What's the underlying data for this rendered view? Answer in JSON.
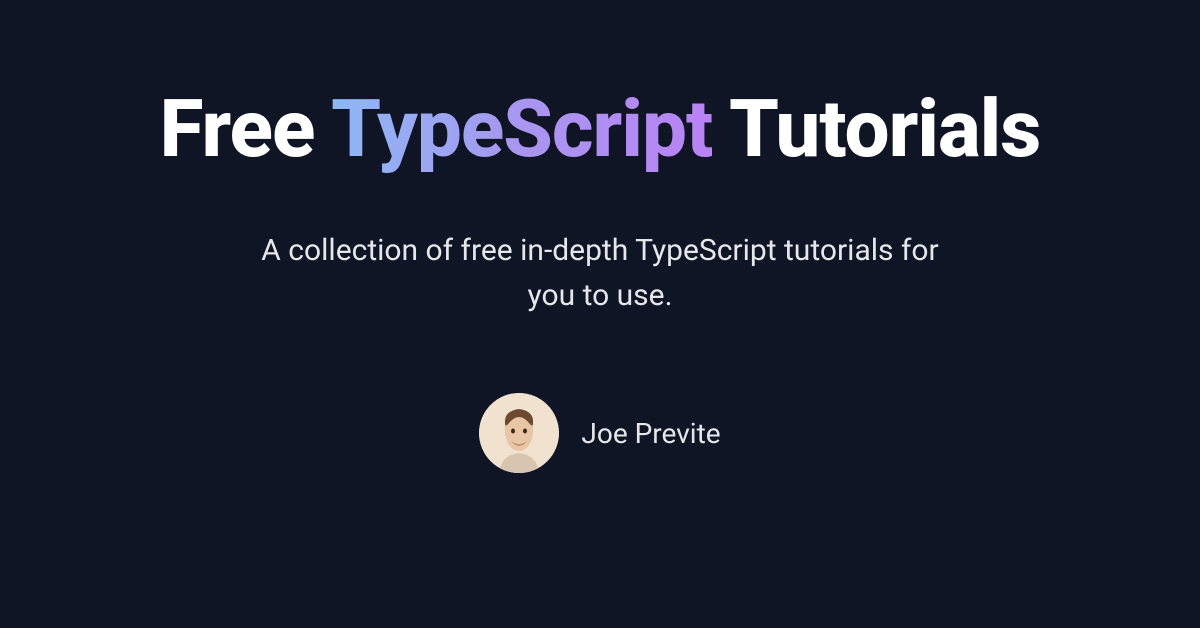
{
  "title": {
    "prefix": "Free ",
    "highlight": "TypeScript",
    "suffix": " Tutorials"
  },
  "subtitle": "A collection of free in-depth TypeScript tutorials for you to use.",
  "author": {
    "name": "Joe Previte"
  }
}
